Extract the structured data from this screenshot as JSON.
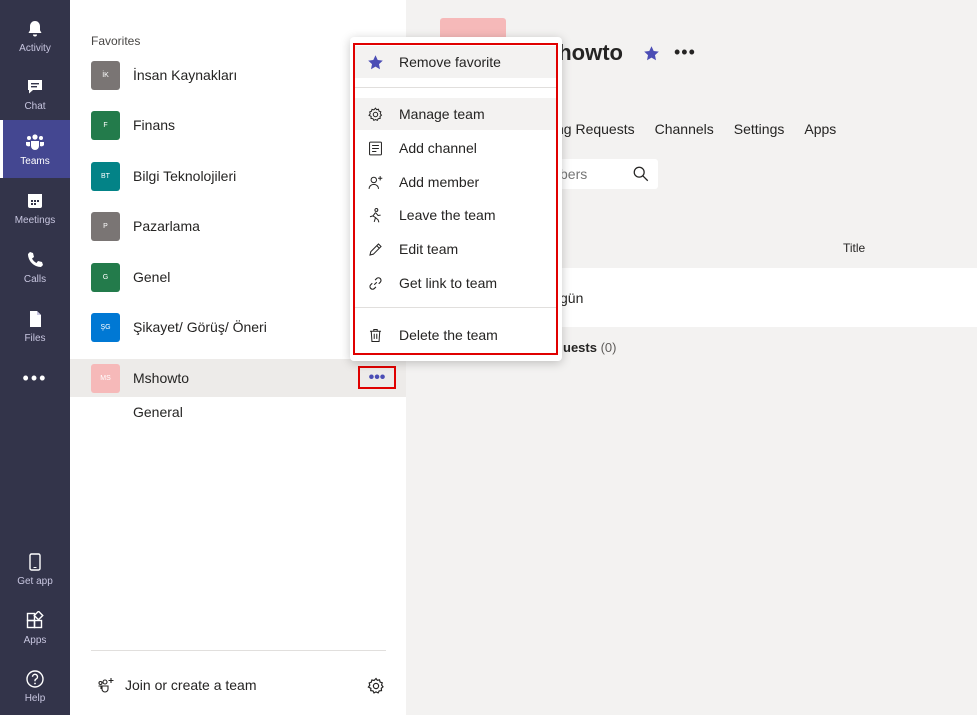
{
  "rail": {
    "items": [
      {
        "label": "Activity",
        "icon": "bell-icon"
      },
      {
        "label": "Chat",
        "icon": "chat-icon"
      },
      {
        "label": "Teams",
        "icon": "teams-icon",
        "active": true
      },
      {
        "label": "Meetings",
        "icon": "calendar-icon"
      },
      {
        "label": "Calls",
        "icon": "phone-icon"
      },
      {
        "label": "Files",
        "icon": "file-icon"
      }
    ],
    "more": "•••",
    "bottom_items": [
      {
        "label": "Get app",
        "icon": "mobile-icon"
      },
      {
        "label": "Apps",
        "icon": "apps-icon"
      },
      {
        "label": "Help",
        "icon": "help-icon"
      }
    ]
  },
  "teams_panel": {
    "favorites_header": "Favorites",
    "teams": [
      {
        "initials": "İK",
        "name": "İnsan Kaynakları",
        "color": "#7a7574"
      },
      {
        "initials": "F",
        "name": "Finans",
        "color": "#237b4b"
      },
      {
        "initials": "BT",
        "name": "Bilgi Teknolojileri",
        "color": "#038387"
      },
      {
        "initials": "P",
        "name": "Pazarlama",
        "color": "#7a7574"
      },
      {
        "initials": "G",
        "name": "Genel",
        "color": "#237b4b"
      },
      {
        "initials": "ŞG",
        "name": "Şikayet/ Görüş/ Öneri",
        "color": "#0078d4"
      },
      {
        "initials": "MS",
        "name": "Mshowto",
        "color": "#f6b9b9"
      }
    ],
    "channel": "General",
    "more_button": "•••",
    "join_label": "Join or create a team"
  },
  "main": {
    "team_title": "showto",
    "more": "•••",
    "tabs": [
      "ng Requests",
      "Channels",
      "Settings",
      "Apps"
    ],
    "search_placeholder": "bers",
    "col_title": "Title",
    "member_name": "gün",
    "guests_label": "uests",
    "guests_count": "(0)"
  },
  "context_menu": {
    "items": [
      {
        "label": "Remove favorite",
        "icon": "star-icon"
      },
      {
        "label": "Manage team",
        "icon": "gear-icon"
      },
      {
        "label": "Add channel",
        "icon": "channel-list-icon"
      },
      {
        "label": "Add member",
        "icon": "add-person-icon"
      },
      {
        "label": "Leave the team",
        "icon": "leave-icon"
      },
      {
        "label": "Edit team",
        "icon": "pencil-icon"
      },
      {
        "label": "Get link to team",
        "icon": "link-icon"
      },
      {
        "label": "Delete the team",
        "icon": "trash-icon"
      }
    ]
  },
  "colors": {
    "rail_bg": "#33344a",
    "accent": "#4b4db5",
    "highlight_outline": "#e00000"
  }
}
